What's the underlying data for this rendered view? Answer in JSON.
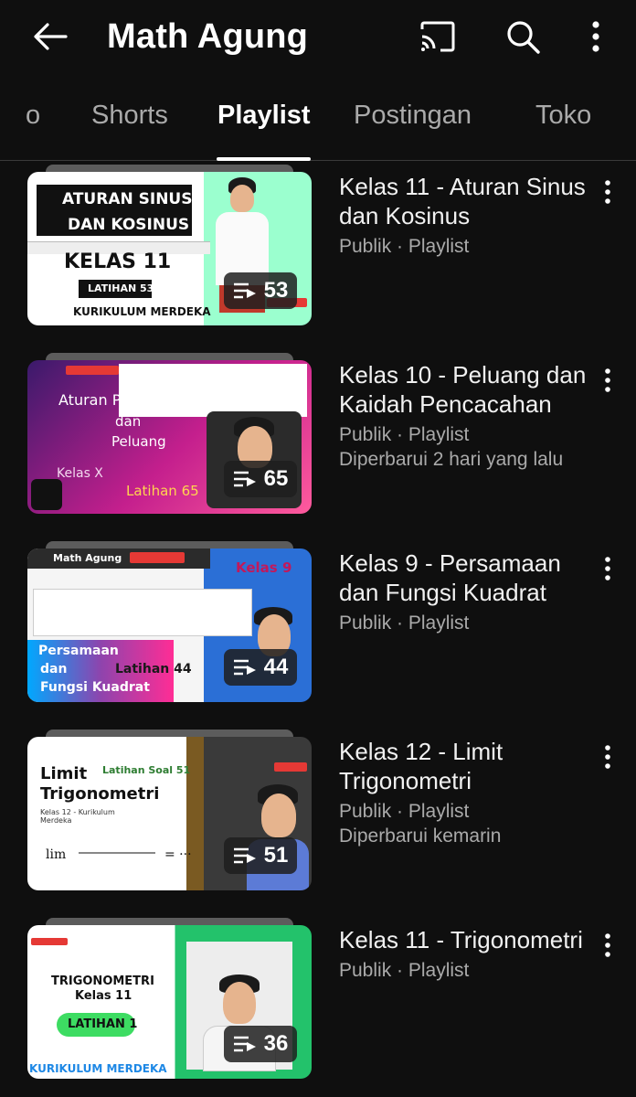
{
  "header": {
    "title": "Math Agung",
    "icons": [
      "back-arrow-icon",
      "cast-icon",
      "search-icon",
      "more-vert-icon"
    ]
  },
  "tabs": [
    {
      "label": "o",
      "active": false
    },
    {
      "label": "Shorts",
      "active": false
    },
    {
      "label": "Playlist",
      "active": true
    },
    {
      "label": "Postingan",
      "active": false
    },
    {
      "label": "Toko",
      "active": false
    }
  ],
  "playlists": [
    {
      "title": "Kelas 11 - Aturan Sinus dan Kosinus",
      "meta": "Publik · Playlist",
      "updated": "",
      "count": "53",
      "thumb_text": [
        "ATURAN SINUS",
        "DAN KOSINUS",
        "KELAS 11",
        "LATIHAN 53",
        "KURIKULUM MERDEKA"
      ]
    },
    {
      "title": "Kelas 10 - Peluang dan Kaidah Pencacahan",
      "meta": "Publik · Playlist",
      "updated": "Diperbarui 2 hari yang lalu",
      "count": "65",
      "thumb_text": [
        "Aturan Pencacahan",
        "dan",
        "Peluang",
        "Kelas X",
        "Latihan 65"
      ]
    },
    {
      "title": "Kelas 9 - Persamaan dan Fungsi Kuadrat",
      "meta": "Publik · Playlist",
      "updated": "",
      "count": "44",
      "thumb_text": [
        "Math Agung",
        "Kelas 9",
        "Persamaan",
        "dan",
        "Fungsi Kuadrat",
        "Latihan 44"
      ]
    },
    {
      "title": "Kelas 12 - Limit Trigonometri",
      "meta": "Publik · Playlist",
      "updated": "Diperbarui kemarin",
      "count": "51",
      "thumb_text": [
        "Limit",
        "Trigonometri",
        "Latihan Soal 51",
        "Kelas 12 - Kurikulum Merdeka"
      ]
    },
    {
      "title": "Kelas 11 - Trigonometri",
      "meta": "Publik · Playlist",
      "updated": "",
      "count": "36",
      "thumb_text": [
        "TRIGONOMETRI",
        "Kelas 11",
        "LATIHAN 1",
        "KURIKULUM MERDEKA"
      ]
    }
  ],
  "colors": {
    "background": "#0f0f0f",
    "text_primary": "#f1f1f1",
    "text_secondary": "#aaaaaa"
  }
}
